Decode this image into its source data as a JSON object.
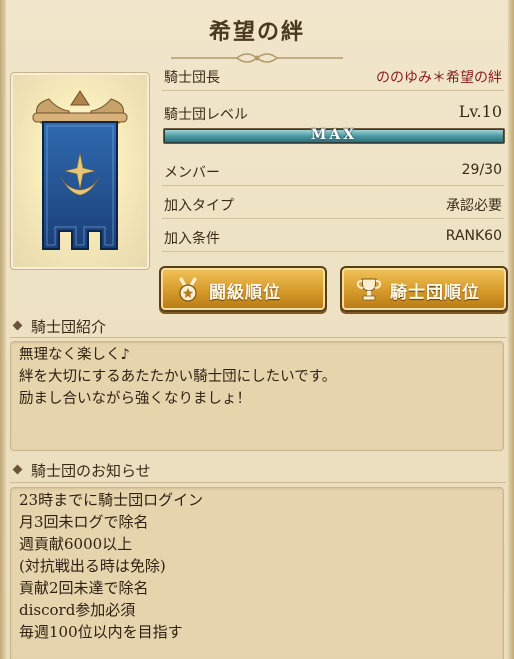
{
  "header": {
    "title": "希望の絆"
  },
  "info": {
    "leader": {
      "label": "騎士団長",
      "value": "ののゆみ＊希望の絆"
    },
    "level": {
      "label": "騎士団レベル",
      "value": "Lv.10",
      "bar_label": "MAX",
      "progress": 1.0
    },
    "members": {
      "label": "メンバー",
      "value": "29/30"
    },
    "join_type": {
      "label": "加入タイプ",
      "value": "承認必要"
    },
    "join_condition": {
      "label": "加入条件",
      "value": "RANK60"
    }
  },
  "buttons": {
    "battle_rank": {
      "label": "闘級順位",
      "icon": "medal-icon"
    },
    "guild_rank": {
      "label": "騎士団順位",
      "icon": "trophy-icon"
    }
  },
  "intro": {
    "heading": "騎士団紹介",
    "lines": [
      "無理なく楽しく♪",
      "絆を大切にするあたたかい騎士団にしたいです。",
      "励まし合いながら強くなりましょ！"
    ]
  },
  "notice": {
    "heading": "騎士団のお知らせ",
    "lines": [
      "23時までに騎士団ログイン",
      "月3回未ログで除名",
      "週貢献6000以上",
      "(対抗戦出る時は免除)",
      "貢献2回未達で除名",
      "discord参加必須",
      "毎週100位以内を目指す"
    ]
  },
  "colors": {
    "background": "#eadcbb",
    "button_gold": "#d59a2a",
    "leader_name": "#8a1b1b",
    "level_bar": "#4c9ba3",
    "banner_blue": "#1f4f8f"
  }
}
